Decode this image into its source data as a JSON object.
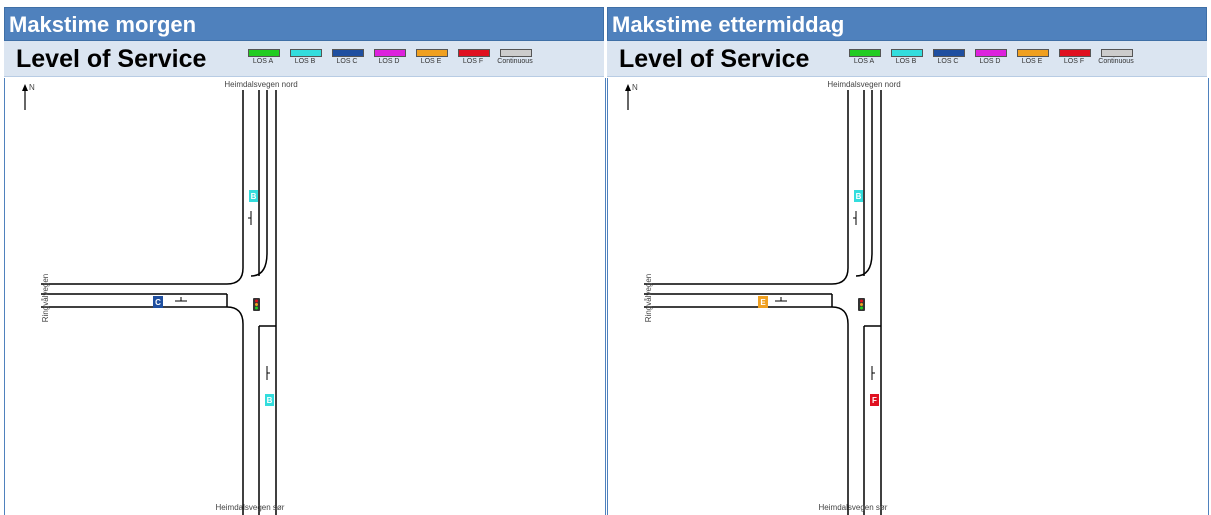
{
  "left": {
    "title": "Makstime morgen",
    "los_heading": "Level of Service",
    "markers": {
      "north": "B",
      "west": "C",
      "south": "B"
    }
  },
  "right": {
    "title": "Makstime ettermiddag",
    "los_heading": "Level of Service",
    "markers": {
      "north": "B",
      "west": "E",
      "south": "F"
    }
  },
  "legend": [
    {
      "label": "LOS A",
      "color": "#22cc22"
    },
    {
      "label": "LOS B",
      "color": "#33dddd"
    },
    {
      "label": "LOS C",
      "color": "#1f4fa0"
    },
    {
      "label": "LOS D",
      "color": "#dd22dd"
    },
    {
      "label": "LOS E",
      "color": "#f0a020"
    },
    {
      "label": "LOS F",
      "color": "#e01020"
    },
    {
      "label": "Continuous",
      "color": "#cccccc"
    }
  ],
  "roads": {
    "north": "Heimdalsvegen nord",
    "south": "Heimdalsvegen sør",
    "west": "Ringvålvegen"
  },
  "compass": "N"
}
